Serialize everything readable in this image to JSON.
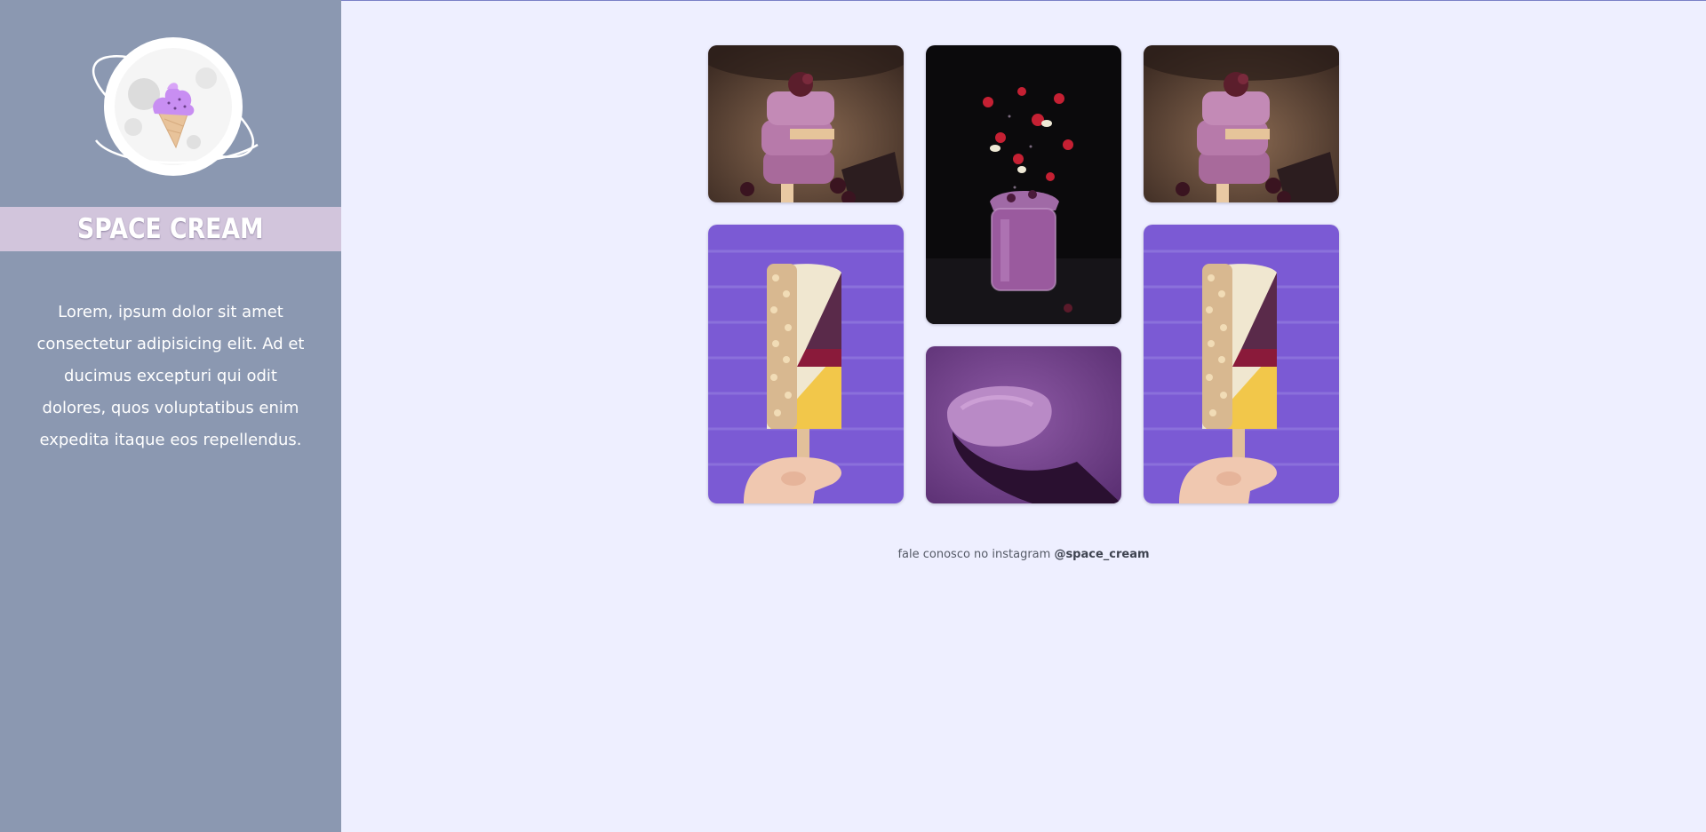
{
  "sidebar": {
    "logo_icon": "ice-cream-planet-icon",
    "title": "SPACE CREAM",
    "description": "Lorem, ipsum dolor sit amet consectetur adipisicing elit. Ad et ducimus excepturi qui odit dolores, quos voluptatibus enim expedita itaque eos repellendus."
  },
  "gallery": {
    "images": [
      {
        "subject": "berry-popsicles"
      },
      {
        "subject": "berry-smoothie-jar"
      },
      {
        "subject": "berry-popsicles"
      },
      {
        "subject": "nut-coated-popsicle"
      },
      {
        "subject": "purple-ice-cream-spoon"
      },
      {
        "subject": "nut-coated-popsicle"
      }
    ]
  },
  "footer": {
    "text": "fale conosco no instagram",
    "handle": "@space_cream"
  },
  "colors": {
    "sidebar_bg": "#8b98b1",
    "brand_bar_bg": "#d2c5dc",
    "page_bg": "#eeefff"
  }
}
